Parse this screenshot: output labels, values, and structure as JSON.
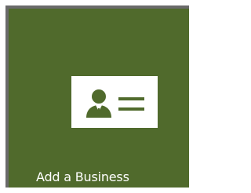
{
  "tile": {
    "label": "Add a Business",
    "icon": "business-card-icon",
    "background_color": "#506a2c",
    "icon_card_color": "#ffffff"
  }
}
